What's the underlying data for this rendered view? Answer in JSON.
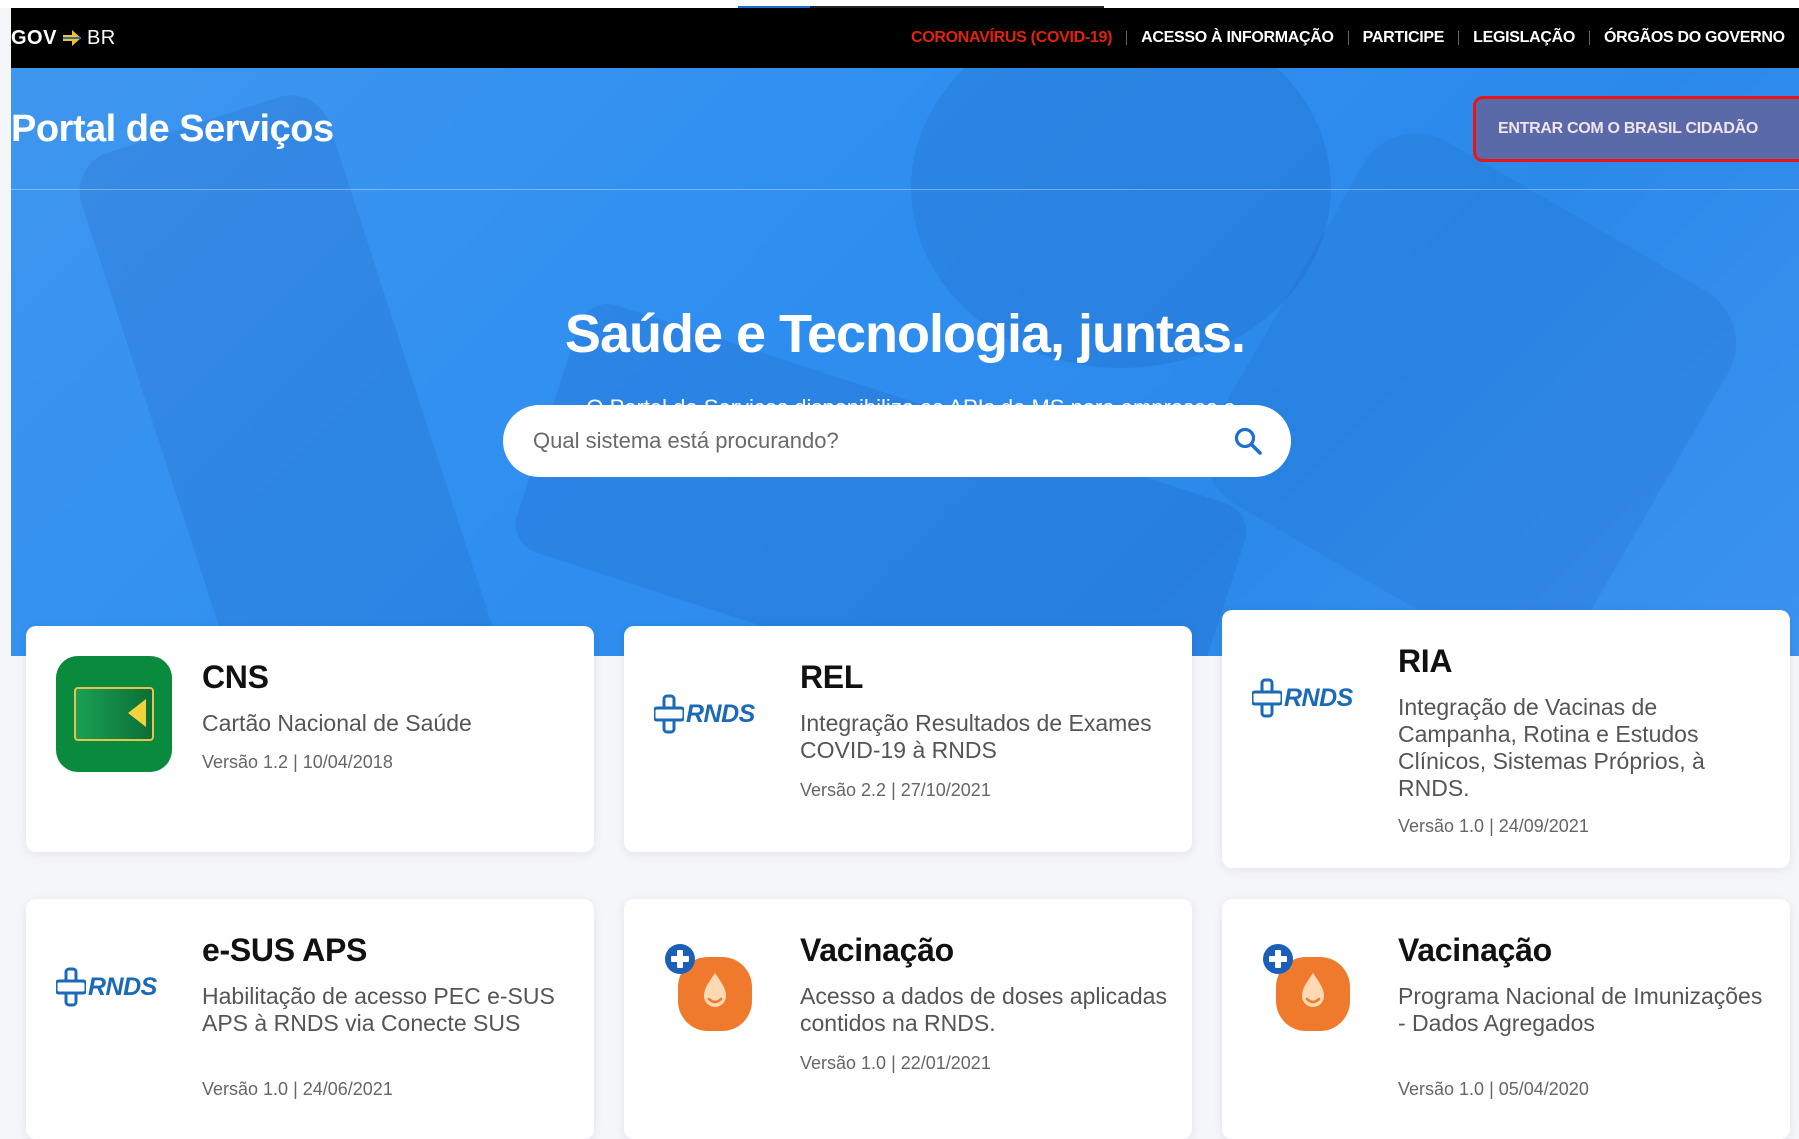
{
  "govbar": {
    "logo": {
      "gov": "GOV",
      "br": "BR"
    },
    "links": [
      {
        "label": "CORONAVÍRUS (COVID-19)",
        "name": "gov-link-coronavirus",
        "covid": true
      },
      {
        "label": "ACESSO À INFORMAÇÃO",
        "name": "gov-link-acesso-informacao"
      },
      {
        "label": "PARTICIPE",
        "name": "gov-link-participe"
      },
      {
        "label": "LEGISLAÇÃO",
        "name": "gov-link-legislacao"
      },
      {
        "label": "ÓRGÃOS DO GOVERNO",
        "name": "gov-link-orgaos"
      }
    ]
  },
  "header": {
    "title": "Portal de Serviços",
    "login_label": "ENTRAR COM O BRASIL CIDADÃO"
  },
  "hero": {
    "headline": "Saúde e Tecnologia, juntas.",
    "subline": "O Portal de Serviços disponibiliza as APIs do MS para empresas e desenvolvedores com foco em saúde pública!"
  },
  "search": {
    "placeholder": "Qual sistema está procurando?",
    "value": ""
  },
  "cards": [
    {
      "title": "CNS",
      "desc": "Cartão Nacional de Saúde",
      "version": "Versão 1.2 | 10/04/2018",
      "logo": "cns"
    },
    {
      "title": "REL",
      "desc": "Integração Resultados de Exames COVID-19 à RNDS",
      "version": "Versão 2.2 | 27/10/2021",
      "logo": "rnds"
    },
    {
      "title": "RIA",
      "desc": "Integração de Vacinas de Campanha, Rotina e Estudos Clínicos, Sistemas Próprios, à RNDS.",
      "version": "Versão 1.0 | 24/09/2021",
      "logo": "rnds"
    },
    {
      "title": "e-SUS APS",
      "desc": "Habilitação de acesso PEC e-SUS APS à RNDS via Conecte SUS",
      "version": "Versão 1.0 | 24/06/2021",
      "logo": "rnds"
    },
    {
      "title": "Vacinação",
      "desc": "Acesso a dados de doses aplicadas contidos na RNDS.",
      "version": "Versão 1.0 | 22/01/2021",
      "logo": "vaccine"
    },
    {
      "title": "Vacinação",
      "desc": "Programa Nacional de Imunizações - Dados Agregados",
      "version": "Versão 1.0 | 05/04/2020",
      "logo": "vaccine"
    }
  ],
  "rnds_logo_text": "RNDS",
  "colors": {
    "covid_red": "#e52207",
    "hero_blue": "#2f8ff0",
    "login_border": "#e8161b",
    "rnds_blue": "#1a6ab8",
    "vaccine_orange": "#f07a2c"
  }
}
